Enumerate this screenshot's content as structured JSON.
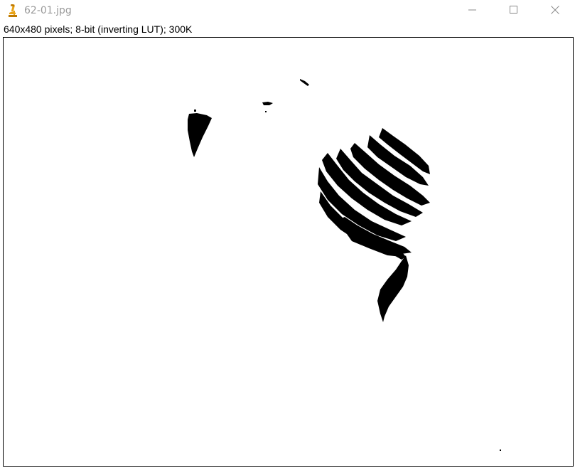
{
  "window": {
    "title": "62-01.jpg",
    "app_icon": "microscope-icon",
    "controls": {
      "minimize": "minimize-icon",
      "maximize": "maximize-icon",
      "close": "close-icon"
    }
  },
  "image_info": {
    "text": "640x480 pixels; 8-bit (inverting LUT); 300K"
  },
  "colors": {
    "foreground": "#000000",
    "background": "#ffffff",
    "icon_accent": "#e8a317"
  }
}
